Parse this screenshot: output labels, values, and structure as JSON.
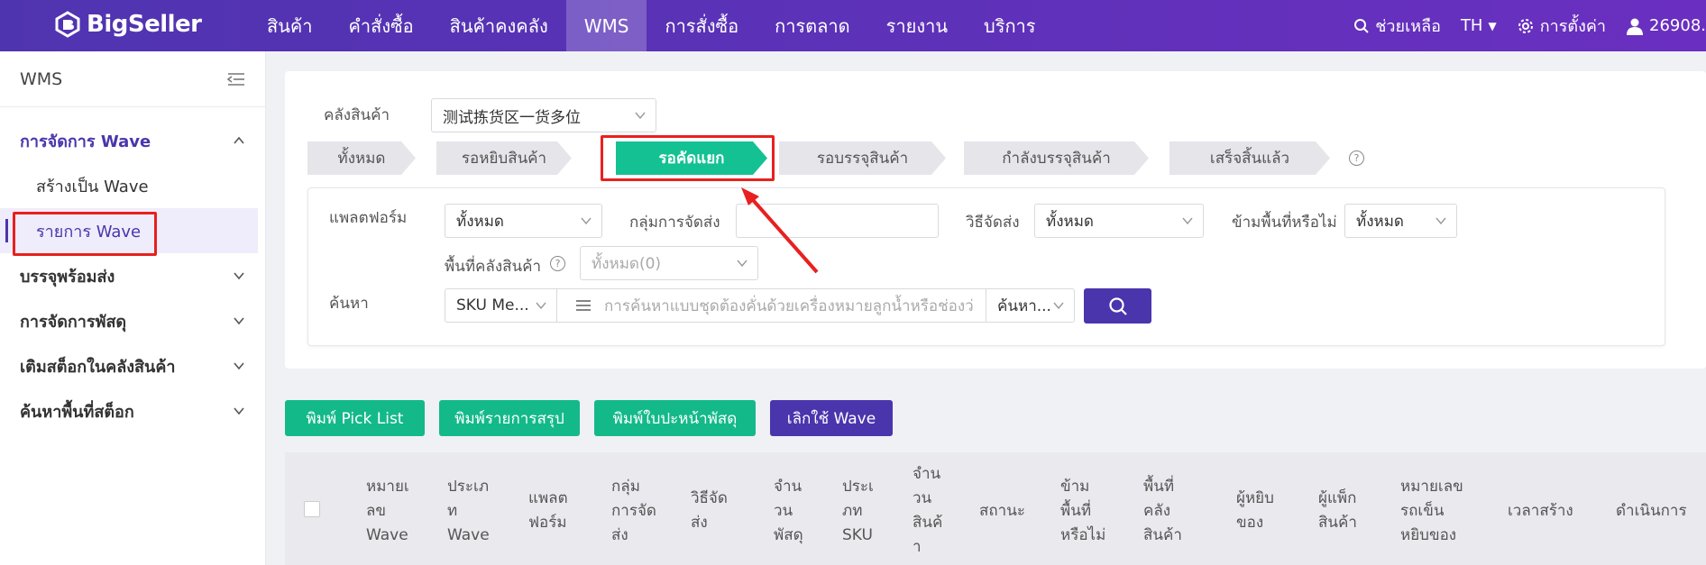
{
  "nav": {
    "logo": "BigSeller",
    "menu": [
      {
        "label": "สินค้า",
        "active": false
      },
      {
        "label": "คำสั่งซื้อ",
        "active": false
      },
      {
        "label": "สินค้าคงคลัง",
        "active": false
      },
      {
        "label": "WMS",
        "active": true
      },
      {
        "label": "การสั่งซื้อ",
        "active": false
      },
      {
        "label": "การตลาด",
        "active": false
      },
      {
        "label": "รายงาน",
        "active": false
      },
      {
        "label": "บริการ",
        "active": false
      }
    ],
    "help": "ช่วยเหลือ",
    "lang": "TH",
    "settings": "การตั้งค่า",
    "user": "26908."
  },
  "sidebar": {
    "title": "WMS",
    "groups": [
      {
        "label": "การจัดการ Wave",
        "open": true,
        "items": [
          {
            "label": "สร้างเป็น Wave",
            "selected": false
          },
          {
            "label": "รายการ Wave",
            "selected": true
          }
        ]
      },
      {
        "label": "บรรจุพร้อมส่ง",
        "open": false
      },
      {
        "label": "การจัดการพัสดุ",
        "open": false
      },
      {
        "label": "เติมสต็อกในคลังสินค้า",
        "open": false
      },
      {
        "label": "ค้นหาพื้นที่สต็อก",
        "open": false
      }
    ]
  },
  "warehouse": {
    "label": "คลังสินค้า",
    "value": "测试拣货区一货多位"
  },
  "steps": [
    {
      "label": "ทั้งหมด",
      "active": false
    },
    {
      "label": "รอหยิบสินค้า",
      "active": false
    },
    {
      "label": "รอคัดแยก",
      "active": true
    },
    {
      "label": "รอบรรจุสินค้า",
      "active": false
    },
    {
      "label": "กำลังบรรจุสินค้า",
      "active": false
    },
    {
      "label": "เสร็จสิ้นแล้ว",
      "active": false
    }
  ],
  "filters": {
    "platform_label": "แพลตฟอร์ม",
    "platform_value": "ทั้งหมด",
    "shipping_group_label": "กลุ่มการจัดส่ง",
    "shipping_group_value": "",
    "shipping_method_label": "วิธีจัดส่ง",
    "shipping_method_value": "ทั้งหมด",
    "skip_area_label": "ข้ามพื้นที่หรือไม่",
    "skip_area_value": "ทั้งหมด",
    "warehouse_area_label": "พื้นที่คลังสินค้า",
    "warehouse_area_placeholder": "ทั้งหมด(0)",
    "search_label": "ค้นหา",
    "search_type": "SKU Me...",
    "search_placeholder": "การค้นหาแบบชุดต้องคั่นด้วยเครื่องหมายลูกน้ำหรือช่องว่",
    "search_mode": "ค้นหา..."
  },
  "actions": [
    {
      "label": "พิมพ์ Pick List",
      "color": "#14b98a"
    },
    {
      "label": "พิมพ์รายการสรุป",
      "color": "#14b98a"
    },
    {
      "label": "พิมพ์ใบปะหน้าพัสดุ",
      "color": "#14b98a"
    },
    {
      "label": "เลิกใช้ Wave",
      "color": "#4b35ad"
    }
  ],
  "table": {
    "headers": [
      [
        "หมายเ",
        "ลข",
        "Wave"
      ],
      [
        "ประเภ",
        "ท",
        "Wave"
      ],
      [
        "แพลต",
        "ฟอร์ม"
      ],
      [
        "กลุ่ม",
        "การจัด",
        "ส่ง"
      ],
      [
        "วิธีจัด",
        "ส่ง"
      ],
      [
        "จำน",
        "วน",
        "พัสดุ"
      ],
      [
        "ประเ",
        "ภท",
        "SKU"
      ],
      [
        "จำน",
        "วน",
        "สินค้",
        "า"
      ],
      [
        "สถานะ"
      ],
      [
        "ข้าม",
        "พื้นที่",
        "หรือไม่"
      ],
      [
        "พื้นที่",
        "คลัง",
        "สินค้า"
      ],
      [
        "ผู้หยิบ",
        "ของ"
      ],
      [
        "ผู้แพ็ก",
        "สินค้า"
      ],
      [
        "หมายเลข",
        "รถเข็น",
        "หยิบของ"
      ],
      [
        "เวลาสร้าง"
      ],
      [
        "ดำเนินการ"
      ]
    ]
  },
  "colors": {
    "brand": "#4b35ad",
    "active_step": "#14c193",
    "highlight": "#e8201f"
  }
}
